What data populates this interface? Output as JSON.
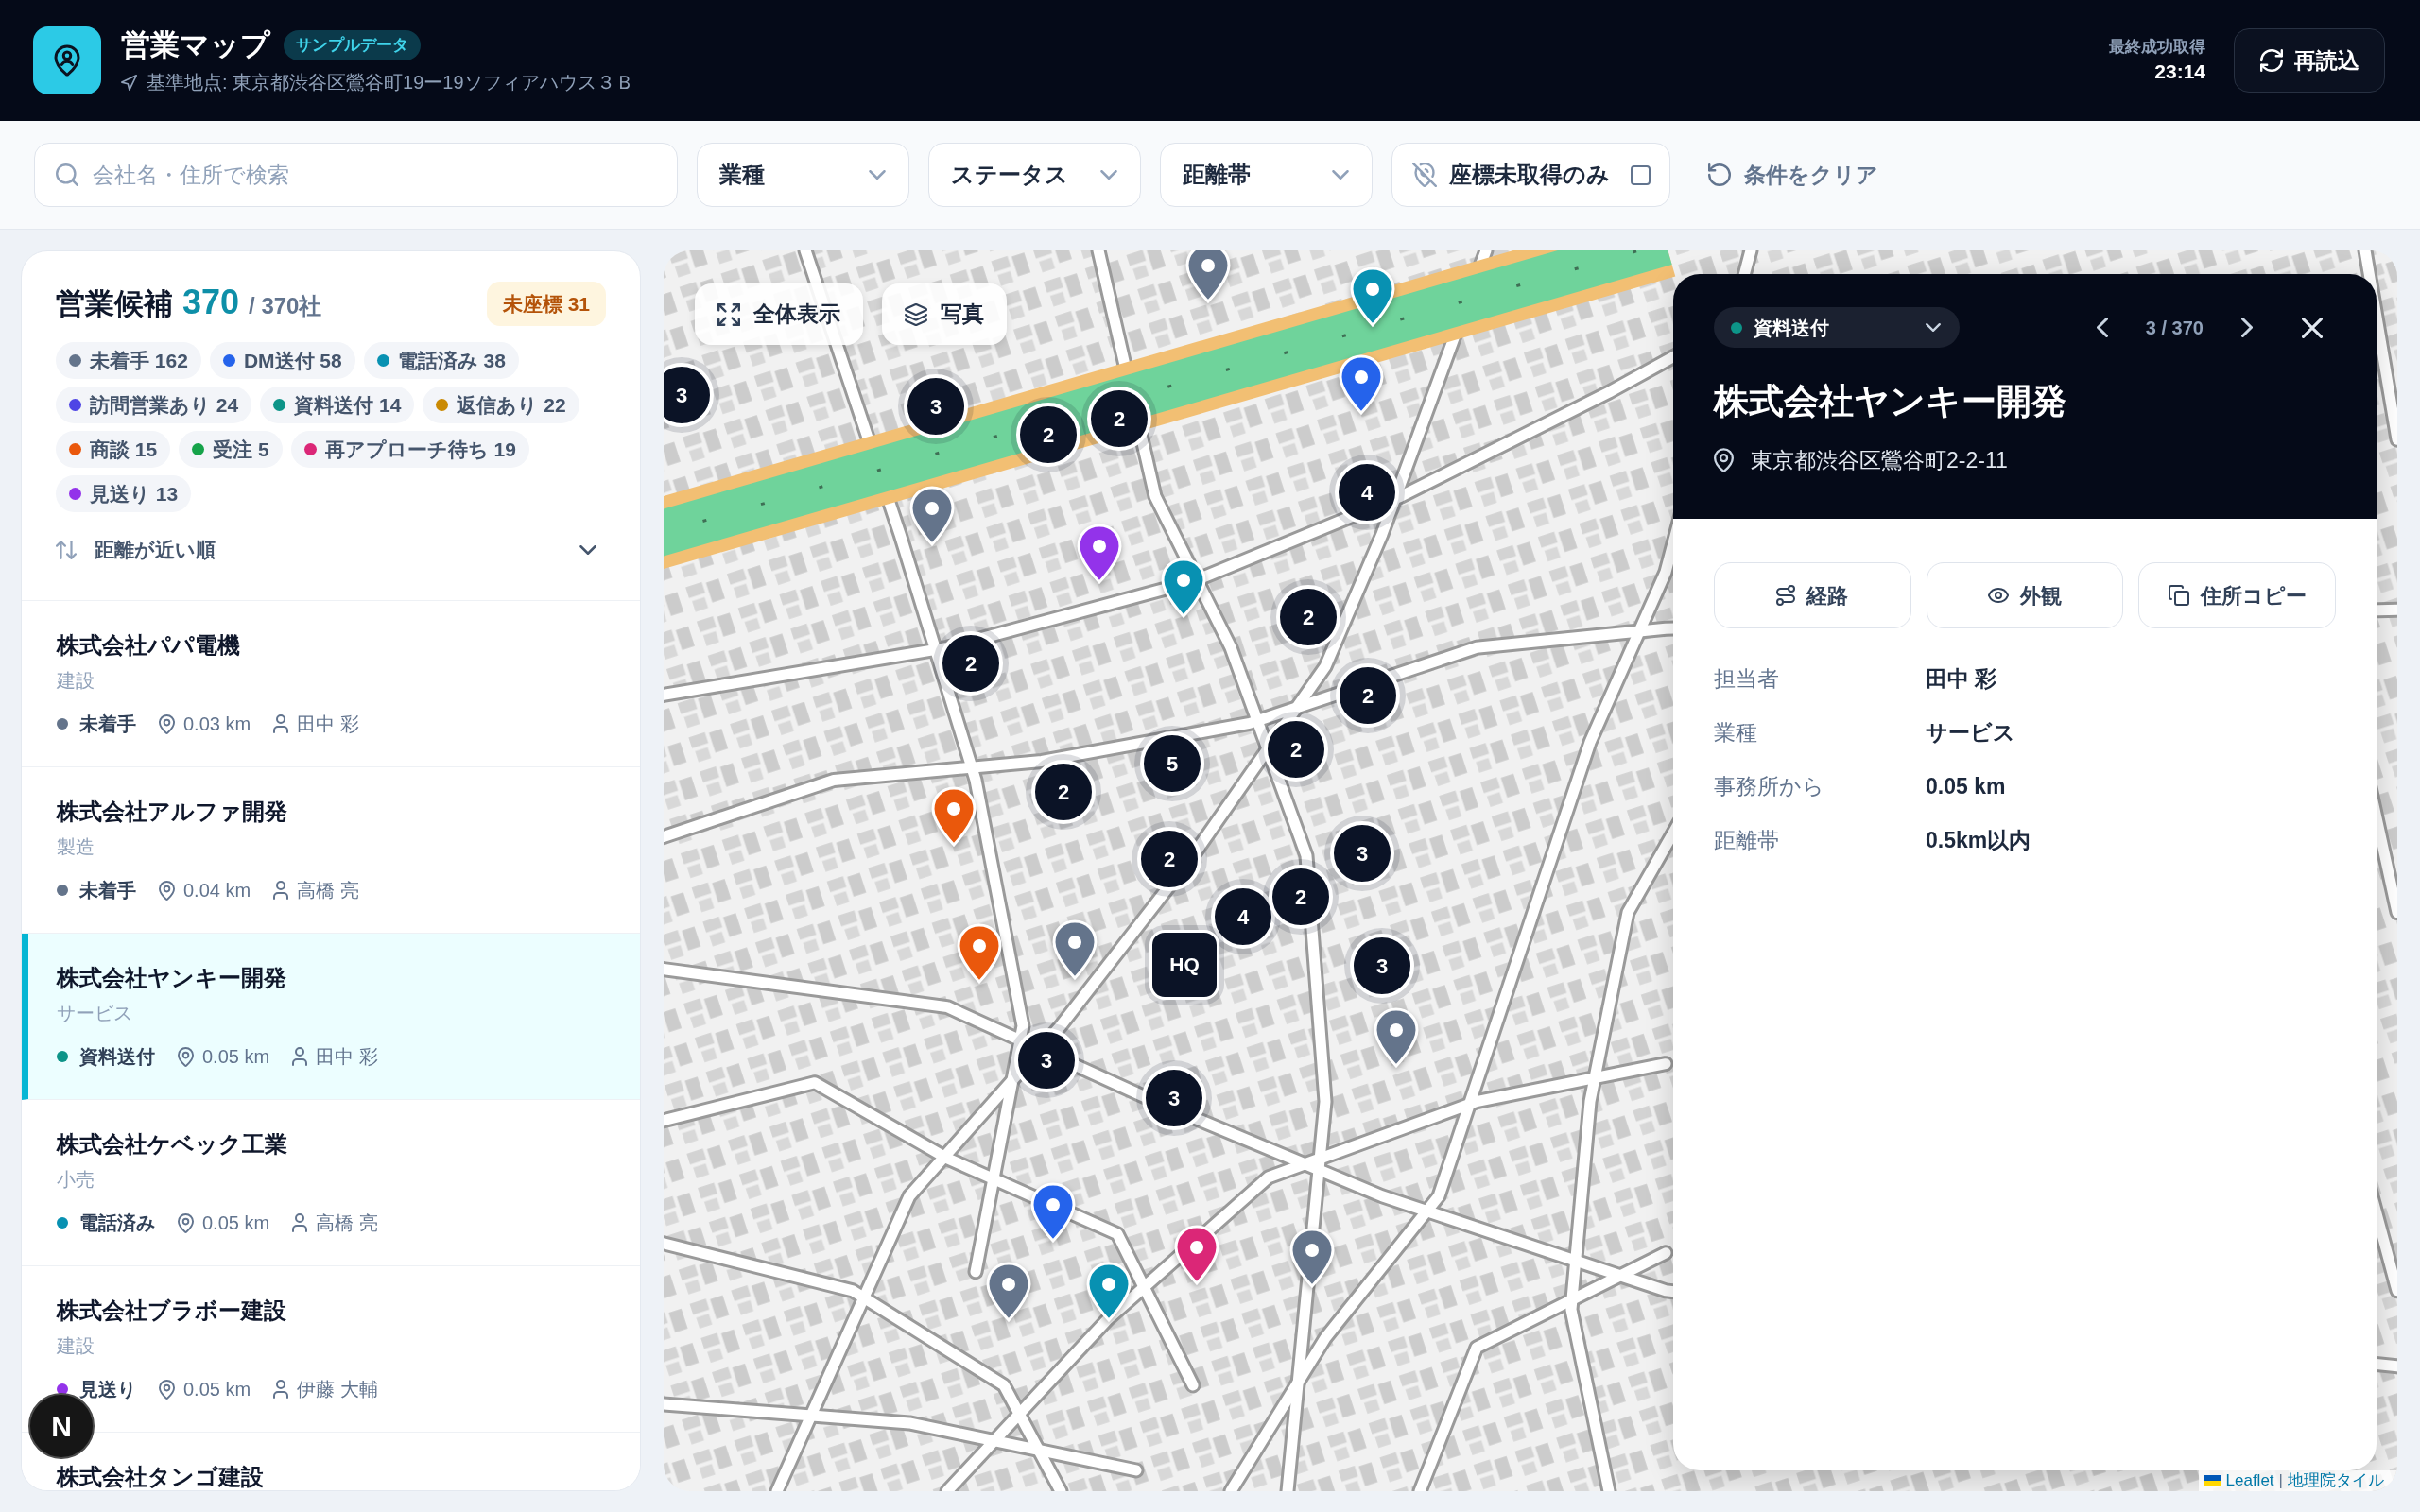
{
  "header": {
    "title": "営業マップ",
    "badge": "サンプルデータ",
    "base_point": "基準地点: 東京都渋谷区鶯谷町19ー19ソフィアハウス３Ｂ",
    "last_fetch": {
      "label": "最終成功取得",
      "time": "23:14"
    },
    "reload_button": "再読込"
  },
  "filters": {
    "search": {
      "placeholder": "会社名・住所で検索"
    },
    "selects": [
      {
        "label": "業種"
      },
      {
        "label": "ステータス"
      },
      {
        "label": "距離帯"
      }
    ],
    "missing_coords_toggle": {
      "label": "座標未取得のみ",
      "checked": false
    },
    "clear_button": "条件をクリア"
  },
  "sidebar": {
    "title": "営業候補",
    "count": "370",
    "total": "/ 370社",
    "missing_badge": "未座標 31",
    "status_counts": [
      {
        "label": "未着手 162",
        "color": "#64748b"
      },
      {
        "label": "DM送付 58",
        "color": "#2563eb"
      },
      {
        "label": "電話済み 38",
        "color": "#0891b2"
      },
      {
        "label": "訪問営業あり 24",
        "color": "#4f46e5"
      },
      {
        "label": "資料送付 14",
        "color": "#0d9488"
      },
      {
        "label": "返信あり 22",
        "color": "#ca8a04"
      },
      {
        "label": "商談 15",
        "color": "#ea580c"
      },
      {
        "label": "受注 5",
        "color": "#16a34a"
      },
      {
        "label": "再アプローチ待ち 19",
        "color": "#db2777"
      },
      {
        "label": "見送り 13",
        "color": "#9333ea"
      }
    ],
    "sort": {
      "label": "距離が近い順"
    },
    "items": [
      {
        "name": "株式会社パパ電機",
        "category": "建設",
        "status": "未着手",
        "color": "#64748b",
        "distance": "0.03 km",
        "owner": "田中 彩",
        "selected": false
      },
      {
        "name": "株式会社アルファ開発",
        "category": "製造",
        "status": "未着手",
        "color": "#64748b",
        "distance": "0.04 km",
        "owner": "高橋 亮",
        "selected": false
      },
      {
        "name": "株式会社ヤンキー開発",
        "category": "サービス",
        "status": "資料送付",
        "color": "#0d9488",
        "distance": "0.05 km",
        "owner": "田中 彩",
        "selected": true
      },
      {
        "name": "株式会社ケベック工業",
        "category": "小売",
        "status": "電話済み",
        "color": "#0891b2",
        "distance": "0.05 km",
        "owner": "高橋 亮",
        "selected": false
      },
      {
        "name": "株式会社ブラボー建設",
        "category": "建設",
        "status": "見送り",
        "color": "#9333ea",
        "distance": "0.05 km",
        "owner": "伊藤 大輔",
        "selected": false
      },
      {
        "name": "株式会社タンゴ建設",
        "selected": false
      }
    ]
  },
  "map": {
    "controls": [
      {
        "kind": "fit",
        "label": "全体表示"
      },
      {
        "kind": "layers",
        "label": "写真"
      }
    ],
    "markers": [
      {
        "kind": "pin",
        "color": "#64748b"
      },
      {
        "kind": "pin",
        "color": "#0891b2"
      },
      {
        "kind": "pin",
        "color": "#2563eb"
      },
      {
        "kind": "cluster",
        "count": "3"
      },
      {
        "kind": "cluster",
        "count": "3"
      },
      {
        "kind": "cluster",
        "count": "2"
      },
      {
        "kind": "cluster",
        "count": "2"
      },
      {
        "kind": "cluster",
        "count": "4"
      },
      {
        "kind": "pin",
        "color": "#64748b"
      },
      {
        "kind": "pin",
        "color": "#9333ea"
      },
      {
        "kind": "pin",
        "color": "#0891b2"
      },
      {
        "kind": "cluster",
        "count": "2"
      },
      {
        "kind": "cluster",
        "count": "2"
      },
      {
        "kind": "cluster",
        "count": "2"
      },
      {
        "kind": "cluster",
        "count": "2"
      },
      {
        "kind": "cluster",
        "count": "5"
      },
      {
        "kind": "cluster",
        "count": "2"
      },
      {
        "kind": "pin",
        "color": "#ea580c"
      },
      {
        "kind": "cluster",
        "count": "3"
      },
      {
        "kind": "cluster",
        "count": "2"
      },
      {
        "kind": "cluster",
        "count": "4"
      },
      {
        "kind": "cluster",
        "count": "2"
      },
      {
        "kind": "pin",
        "color": "#64748b"
      },
      {
        "kind": "pin",
        "color": "#ea580c"
      },
      {
        "kind": "hq",
        "label": "HQ"
      },
      {
        "kind": "cluster",
        "count": "3"
      },
      {
        "kind": "pin",
        "color": "#64748b"
      },
      {
        "kind": "cluster",
        "count": "3"
      },
      {
        "kind": "cluster",
        "count": "3"
      },
      {
        "kind": "pin",
        "color": "#2563eb"
      },
      {
        "kind": "pin",
        "color": "#db2777"
      },
      {
        "kind": "pin",
        "color": "#64748b"
      },
      {
        "kind": "pin",
        "color": "#64748b"
      },
      {
        "kind": "pin",
        "color": "#0891b2"
      }
    ],
    "attribution": {
      "links": [
        "Leaflet",
        "地理院タイル"
      ],
      "separator": "|"
    }
  },
  "detail": {
    "status": {
      "label": "資料送付",
      "color": "#0d9488"
    },
    "position": "3 / 370",
    "name": "株式会社ヤンキー開発",
    "address": "東京都渋谷区鶯谷町2-2-11",
    "actions": [
      {
        "kind": "route",
        "label": "経路"
      },
      {
        "kind": "view",
        "label": "外観"
      },
      {
        "kind": "copy",
        "label": "住所コピー"
      }
    ],
    "fields": [
      {
        "label": "担当者",
        "value": "田中 彩"
      },
      {
        "label": "業種",
        "value": "サービス"
      },
      {
        "label": "事務所から",
        "value": "0.05 km"
      },
      {
        "label": "距離帯",
        "value": "0.5km以内"
      }
    ]
  },
  "dev_badge": {
    "label": "N"
  }
}
